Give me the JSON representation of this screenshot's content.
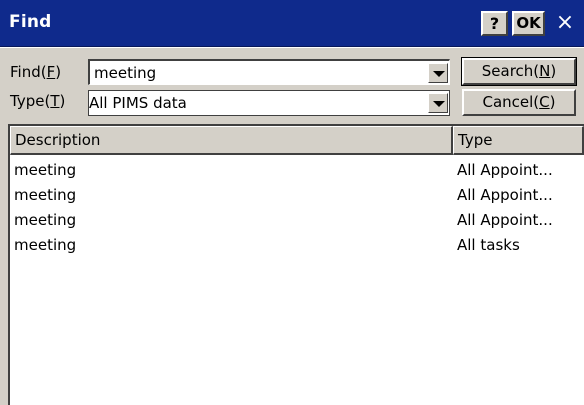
{
  "window": {
    "title": "Find",
    "help_label": "?",
    "ok_label": "OK",
    "close_glyph": "×"
  },
  "find_field": {
    "label_prefix": "Find(",
    "label_key": "F",
    "label_suffix": ")",
    "value": "meeting"
  },
  "type_field": {
    "label_prefix": "Type(",
    "label_key": "T",
    "label_suffix": ")",
    "value": "All PIMS data"
  },
  "buttons": {
    "search_prefix": "Search(",
    "search_key": "N",
    "search_suffix": ")",
    "cancel_prefix": "Cancel(",
    "cancel_key": "C",
    "cancel_suffix": ")"
  },
  "results": {
    "columns": [
      "Description",
      "Type"
    ],
    "rows": [
      {
        "description": "meeting",
        "type": "All Appoint..."
      },
      {
        "description": "meeting",
        "type": "All Appoint..."
      },
      {
        "description": "meeting",
        "type": "All Appoint..."
      },
      {
        "description": "meeting",
        "type": "All tasks"
      }
    ]
  },
  "icons": {
    "dropdown": "chevron-down-icon",
    "close": "close-icon",
    "help": "help-icon"
  },
  "colors": {
    "titlebar": "#0f2a8c",
    "face": "#d4d0c8"
  }
}
